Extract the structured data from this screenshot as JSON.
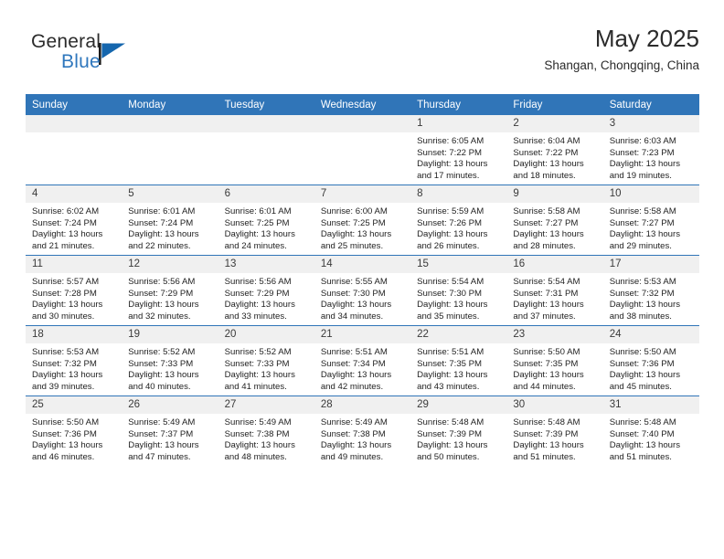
{
  "brand": {
    "name_part1": "General",
    "name_part2": "Blue",
    "logo_icon": "triangle-flag-icon",
    "accent_color": "#2f77bd"
  },
  "header": {
    "title": "May 2025",
    "subtitle": "Shangan, Chongqing, China"
  },
  "theme": {
    "header_blue": "#3075b8",
    "daynum_gray": "#f0f0f0"
  },
  "columns": [
    "Sunday",
    "Monday",
    "Tuesday",
    "Wednesday",
    "Thursday",
    "Friday",
    "Saturday"
  ],
  "weeks": [
    [
      {
        "day": "",
        "lines": []
      },
      {
        "day": "",
        "lines": []
      },
      {
        "day": "",
        "lines": []
      },
      {
        "day": "",
        "lines": []
      },
      {
        "day": "1",
        "lines": [
          "Sunrise: 6:05 AM",
          "Sunset: 7:22 PM",
          "Daylight: 13 hours",
          "and 17 minutes."
        ]
      },
      {
        "day": "2",
        "lines": [
          "Sunrise: 6:04 AM",
          "Sunset: 7:22 PM",
          "Daylight: 13 hours",
          "and 18 minutes."
        ]
      },
      {
        "day": "3",
        "lines": [
          "Sunrise: 6:03 AM",
          "Sunset: 7:23 PM",
          "Daylight: 13 hours",
          "and 19 minutes."
        ]
      }
    ],
    [
      {
        "day": "4",
        "lines": [
          "Sunrise: 6:02 AM",
          "Sunset: 7:24 PM",
          "Daylight: 13 hours",
          "and 21 minutes."
        ]
      },
      {
        "day": "5",
        "lines": [
          "Sunrise: 6:01 AM",
          "Sunset: 7:24 PM",
          "Daylight: 13 hours",
          "and 22 minutes."
        ]
      },
      {
        "day": "6",
        "lines": [
          "Sunrise: 6:01 AM",
          "Sunset: 7:25 PM",
          "Daylight: 13 hours",
          "and 24 minutes."
        ]
      },
      {
        "day": "7",
        "lines": [
          "Sunrise: 6:00 AM",
          "Sunset: 7:25 PM",
          "Daylight: 13 hours",
          "and 25 minutes."
        ]
      },
      {
        "day": "8",
        "lines": [
          "Sunrise: 5:59 AM",
          "Sunset: 7:26 PM",
          "Daylight: 13 hours",
          "and 26 minutes."
        ]
      },
      {
        "day": "9",
        "lines": [
          "Sunrise: 5:58 AM",
          "Sunset: 7:27 PM",
          "Daylight: 13 hours",
          "and 28 minutes."
        ]
      },
      {
        "day": "10",
        "lines": [
          "Sunrise: 5:58 AM",
          "Sunset: 7:27 PM",
          "Daylight: 13 hours",
          "and 29 minutes."
        ]
      }
    ],
    [
      {
        "day": "11",
        "lines": [
          "Sunrise: 5:57 AM",
          "Sunset: 7:28 PM",
          "Daylight: 13 hours",
          "and 30 minutes."
        ]
      },
      {
        "day": "12",
        "lines": [
          "Sunrise: 5:56 AM",
          "Sunset: 7:29 PM",
          "Daylight: 13 hours",
          "and 32 minutes."
        ]
      },
      {
        "day": "13",
        "lines": [
          "Sunrise: 5:56 AM",
          "Sunset: 7:29 PM",
          "Daylight: 13 hours",
          "and 33 minutes."
        ]
      },
      {
        "day": "14",
        "lines": [
          "Sunrise: 5:55 AM",
          "Sunset: 7:30 PM",
          "Daylight: 13 hours",
          "and 34 minutes."
        ]
      },
      {
        "day": "15",
        "lines": [
          "Sunrise: 5:54 AM",
          "Sunset: 7:30 PM",
          "Daylight: 13 hours",
          "and 35 minutes."
        ]
      },
      {
        "day": "16",
        "lines": [
          "Sunrise: 5:54 AM",
          "Sunset: 7:31 PM",
          "Daylight: 13 hours",
          "and 37 minutes."
        ]
      },
      {
        "day": "17",
        "lines": [
          "Sunrise: 5:53 AM",
          "Sunset: 7:32 PM",
          "Daylight: 13 hours",
          "and 38 minutes."
        ]
      }
    ],
    [
      {
        "day": "18",
        "lines": [
          "Sunrise: 5:53 AM",
          "Sunset: 7:32 PM",
          "Daylight: 13 hours",
          "and 39 minutes."
        ]
      },
      {
        "day": "19",
        "lines": [
          "Sunrise: 5:52 AM",
          "Sunset: 7:33 PM",
          "Daylight: 13 hours",
          "and 40 minutes."
        ]
      },
      {
        "day": "20",
        "lines": [
          "Sunrise: 5:52 AM",
          "Sunset: 7:33 PM",
          "Daylight: 13 hours",
          "and 41 minutes."
        ]
      },
      {
        "day": "21",
        "lines": [
          "Sunrise: 5:51 AM",
          "Sunset: 7:34 PM",
          "Daylight: 13 hours",
          "and 42 minutes."
        ]
      },
      {
        "day": "22",
        "lines": [
          "Sunrise: 5:51 AM",
          "Sunset: 7:35 PM",
          "Daylight: 13 hours",
          "and 43 minutes."
        ]
      },
      {
        "day": "23",
        "lines": [
          "Sunrise: 5:50 AM",
          "Sunset: 7:35 PM",
          "Daylight: 13 hours",
          "and 44 minutes."
        ]
      },
      {
        "day": "24",
        "lines": [
          "Sunrise: 5:50 AM",
          "Sunset: 7:36 PM",
          "Daylight: 13 hours",
          "and 45 minutes."
        ]
      }
    ],
    [
      {
        "day": "25",
        "lines": [
          "Sunrise: 5:50 AM",
          "Sunset: 7:36 PM",
          "Daylight: 13 hours",
          "and 46 minutes."
        ]
      },
      {
        "day": "26",
        "lines": [
          "Sunrise: 5:49 AM",
          "Sunset: 7:37 PM",
          "Daylight: 13 hours",
          "and 47 minutes."
        ]
      },
      {
        "day": "27",
        "lines": [
          "Sunrise: 5:49 AM",
          "Sunset: 7:38 PM",
          "Daylight: 13 hours",
          "and 48 minutes."
        ]
      },
      {
        "day": "28",
        "lines": [
          "Sunrise: 5:49 AM",
          "Sunset: 7:38 PM",
          "Daylight: 13 hours",
          "and 49 minutes."
        ]
      },
      {
        "day": "29",
        "lines": [
          "Sunrise: 5:48 AM",
          "Sunset: 7:39 PM",
          "Daylight: 13 hours",
          "and 50 minutes."
        ]
      },
      {
        "day": "30",
        "lines": [
          "Sunrise: 5:48 AM",
          "Sunset: 7:39 PM",
          "Daylight: 13 hours",
          "and 51 minutes."
        ]
      },
      {
        "day": "31",
        "lines": [
          "Sunrise: 5:48 AM",
          "Sunset: 7:40 PM",
          "Daylight: 13 hours",
          "and 51 minutes."
        ]
      }
    ]
  ]
}
